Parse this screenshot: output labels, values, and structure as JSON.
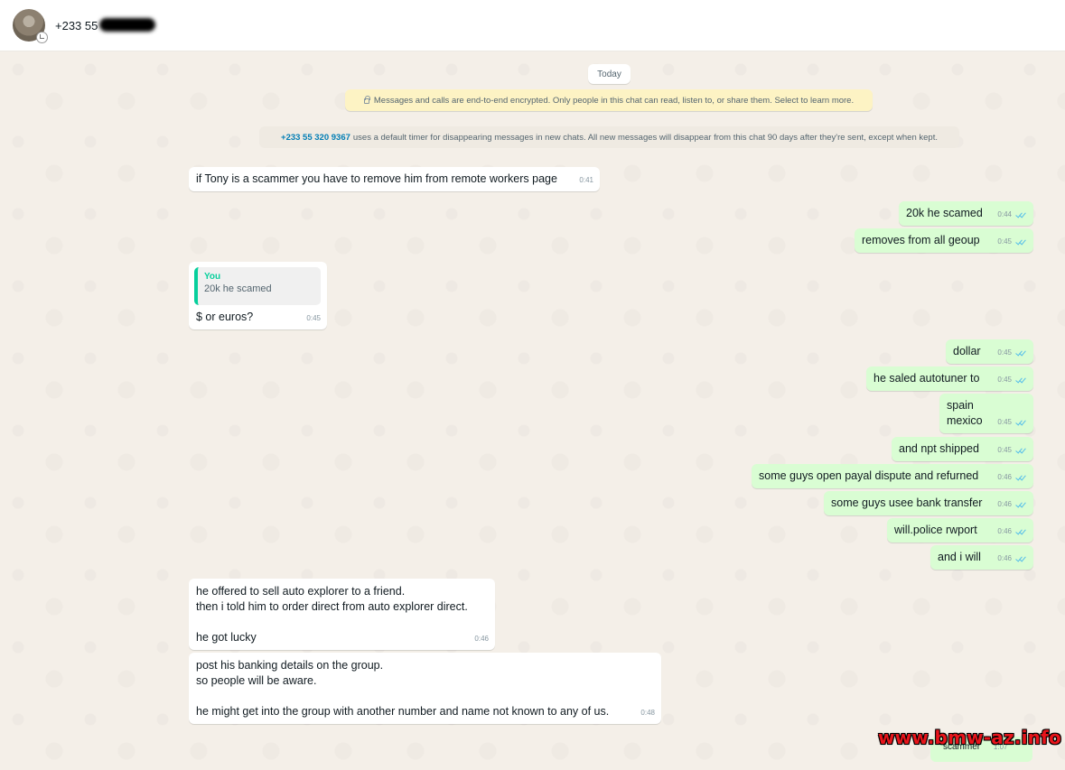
{
  "header": {
    "contact_name": "+233 55"
  },
  "system": {
    "date_label": "Today",
    "encryption_notice": "Messages and calls are end-to-end encrypted. Only people in this chat can read, listen to, or share them. Select to learn more.",
    "timer_phone": "+233 55 320 9367",
    "timer_notice": "uses a default timer for disappearing messages in new chats. All new messages will disappear from this chat 90 days after they're sent, except when kept."
  },
  "messages": [
    {
      "text": "if Tony is a scammer you have to remove him from remote workers page",
      "time": "0:41"
    },
    {
      "text": "20k he scamed",
      "time": "0:44"
    },
    {
      "text": "removes from all geoup",
      "time": "0:45"
    },
    {
      "quote_author": "You",
      "quote_text": "20k he scamed",
      "text": "$ or euros?",
      "time": "0:45"
    },
    {
      "text": "dollar",
      "time": "0:45"
    },
    {
      "text": "he saled autotuner to",
      "time": "0:45"
    },
    {
      "text": "spain\nmexico",
      "time": "0:45"
    },
    {
      "text": "and npt shipped",
      "time": "0:45"
    },
    {
      "text": "some guys open payal dispute and refurned",
      "time": "0:46"
    },
    {
      "text": "some guys usee bank transfer",
      "time": "0:46"
    },
    {
      "text": "will.police rwport",
      "time": "0:46"
    },
    {
      "text": "and i will",
      "time": "0:46"
    },
    {
      "text": "he offered to sell auto explorer to a friend.\nthen i told him to order direct from auto explorer direct.\n\nhe got lucky",
      "time": "0:46"
    },
    {
      "text": "post his banking details on the group.\nso people will be aware.\n\nhe might get into the group with another number and name not known to any of us.",
      "time": "0:48"
    },
    {
      "text": "scammer",
      "time": "1:07"
    }
  ],
  "watermark": "www.bmw-az.info",
  "colors": {
    "incoming": "#ffffff",
    "outgoing": "#d9fdd3",
    "read_tick": "#53bdeb",
    "quote_accent": "#06cf9c",
    "watermark": "#e8141b"
  }
}
